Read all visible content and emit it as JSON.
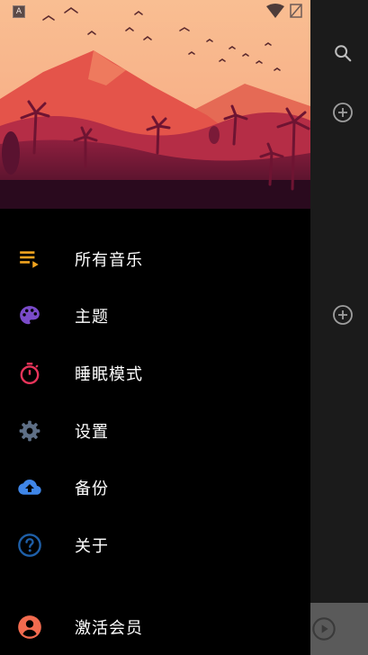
{
  "menu": {
    "items": [
      {
        "label": "所有音乐",
        "icon": "playlist-icon",
        "color": "#F2A41F"
      },
      {
        "label": "主题",
        "icon": "palette-icon",
        "color": "#7A4BC9"
      },
      {
        "label": "睡眠模式",
        "icon": "timer-icon",
        "color": "#E8345A"
      },
      {
        "label": "设置",
        "icon": "gear-icon",
        "color": "#5E6F86"
      },
      {
        "label": "备份",
        "icon": "cloud-upload-icon",
        "color": "#3F86E8"
      },
      {
        "label": "关于",
        "icon": "help-circle-icon",
        "color": "#1E5FA8"
      },
      {
        "label": "激活会员",
        "icon": "account-circle-icon",
        "color": "#F26B4F"
      }
    ]
  },
  "status_bar": {
    "notification_icon": "A",
    "wifi_icon": "wifi-icon",
    "battery_icon": "battery-icon"
  },
  "colors": {
    "drawer_background": "#000000",
    "sky": "#F7B089",
    "mountain": "#E3594B"
  }
}
